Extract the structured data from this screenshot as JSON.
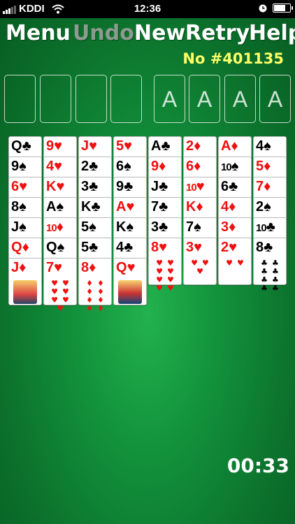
{
  "status_bar": {
    "carrier": "KDDI",
    "time": "12:36"
  },
  "menu": {
    "menu": "Menu",
    "undo": "Undo",
    "new": "New",
    "retry": "Retry",
    "help": "Help"
  },
  "game_number": "No #401135",
  "freecells": [
    "",
    "",
    "",
    ""
  ],
  "foundations": [
    "A",
    "A",
    "A",
    "A"
  ],
  "columns": [
    [
      {
        "rank": "Q",
        "suit": "♣"
      },
      {
        "rank": "9",
        "suit": "♠"
      },
      {
        "rank": "6",
        "suit": "♥"
      },
      {
        "rank": "8",
        "suit": "♠"
      },
      {
        "rank": "J",
        "suit": "♠"
      },
      {
        "rank": "Q",
        "suit": "♦"
      },
      {
        "rank": "J",
        "suit": "♦"
      }
    ],
    [
      {
        "rank": "9",
        "suit": "♥"
      },
      {
        "rank": "4",
        "suit": "♥"
      },
      {
        "rank": "K",
        "suit": "♥"
      },
      {
        "rank": "A",
        "suit": "♠"
      },
      {
        "rank": "10",
        "suit": "♦"
      },
      {
        "rank": "Q",
        "suit": "♠"
      },
      {
        "rank": "7",
        "suit": "♥"
      }
    ],
    [
      {
        "rank": "J",
        "suit": "♥"
      },
      {
        "rank": "2",
        "suit": "♣"
      },
      {
        "rank": "3",
        "suit": "♣"
      },
      {
        "rank": "K",
        "suit": "♣"
      },
      {
        "rank": "5",
        "suit": "♠"
      },
      {
        "rank": "5",
        "suit": "♣"
      },
      {
        "rank": "8",
        "suit": "♦"
      }
    ],
    [
      {
        "rank": "5",
        "suit": "♥"
      },
      {
        "rank": "6",
        "suit": "♠"
      },
      {
        "rank": "9",
        "suit": "♣"
      },
      {
        "rank": "A",
        "suit": "♥"
      },
      {
        "rank": "K",
        "suit": "♠"
      },
      {
        "rank": "4",
        "suit": "♣"
      },
      {
        "rank": "Q",
        "suit": "♥"
      }
    ],
    [
      {
        "rank": "A",
        "suit": "♣"
      },
      {
        "rank": "9",
        "suit": "♦"
      },
      {
        "rank": "J",
        "suit": "♣"
      },
      {
        "rank": "7",
        "suit": "♣"
      },
      {
        "rank": "3",
        "suit": "♣"
      },
      {
        "rank": "8",
        "suit": "♥"
      }
    ],
    [
      {
        "rank": "2",
        "suit": "♦"
      },
      {
        "rank": "6",
        "suit": "♦"
      },
      {
        "rank": "10",
        "suit": "♥"
      },
      {
        "rank": "K",
        "suit": "♦"
      },
      {
        "rank": "7",
        "suit": "♠"
      },
      {
        "rank": "3",
        "suit": "♥"
      }
    ],
    [
      {
        "rank": "A",
        "suit": "♦"
      },
      {
        "rank": "10",
        "suit": "♠"
      },
      {
        "rank": "6",
        "suit": "♣"
      },
      {
        "rank": "4",
        "suit": "♦"
      },
      {
        "rank": "3",
        "suit": "♦"
      },
      {
        "rank": "2",
        "suit": "♥"
      }
    ],
    [
      {
        "rank": "4",
        "suit": "♠"
      },
      {
        "rank": "5",
        "suit": "♦"
      },
      {
        "rank": "7",
        "suit": "♦"
      },
      {
        "rank": "2",
        "suit": "♠"
      },
      {
        "rank": "10",
        "suit": "♣"
      },
      {
        "rank": "8",
        "suit": "♣"
      }
    ]
  ],
  "timer": "00:33",
  "colors": {
    "felt": "#12913b",
    "red_suit": "#e11111",
    "game_number": "#ffff66",
    "undo_disabled": "#8d9a8f"
  }
}
